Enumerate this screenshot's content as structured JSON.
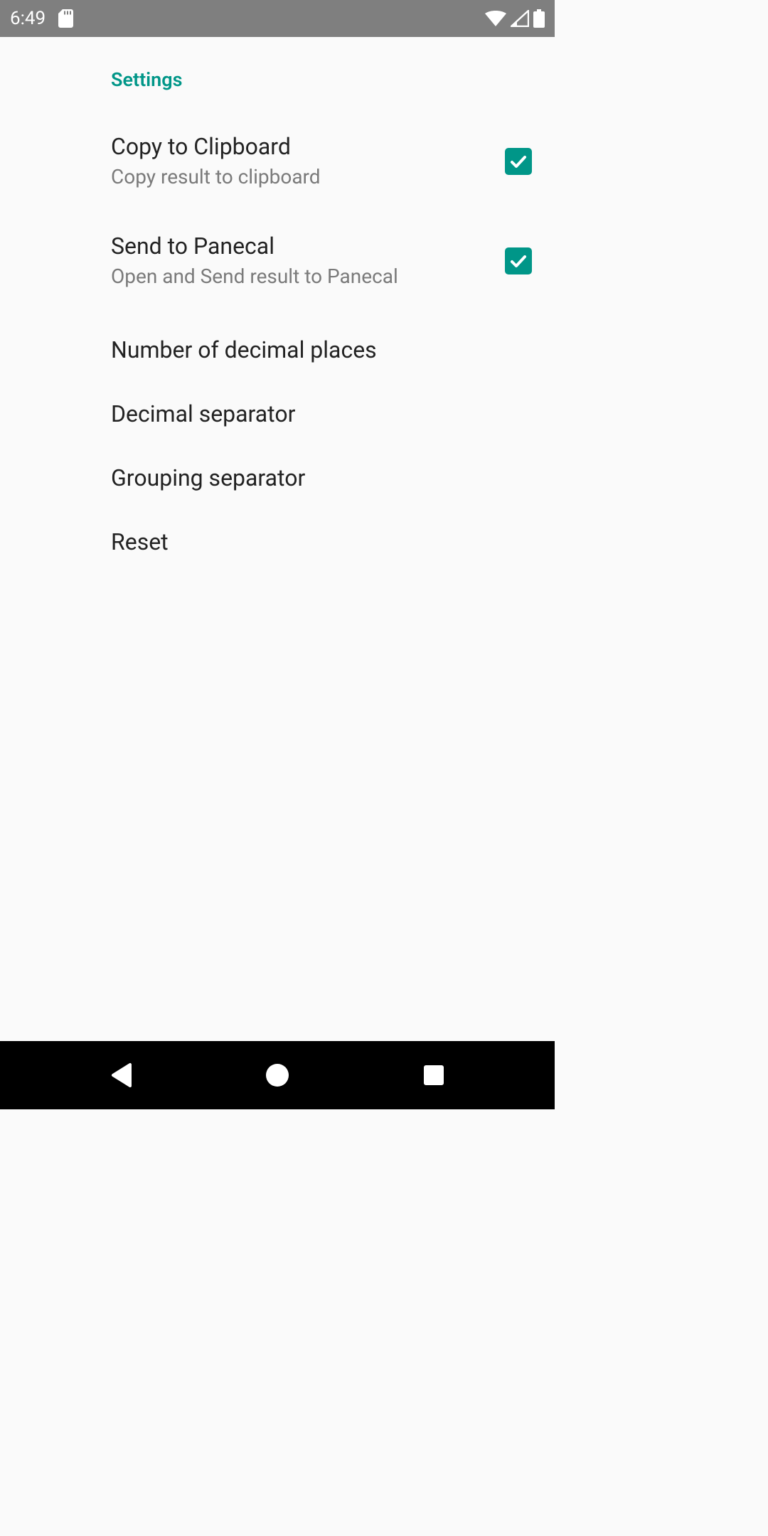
{
  "statusbar": {
    "time": "6:49"
  },
  "page": {
    "section_title": "Settings"
  },
  "settings": {
    "copy_clipboard": {
      "title": "Copy to Clipboard",
      "subtitle": "Copy result to clipboard",
      "checked": true
    },
    "send_panecal": {
      "title": "Send to Panecal",
      "subtitle": "Open and Send result to Panecal",
      "checked": true
    },
    "decimal_places": {
      "title": "Number of decimal places"
    },
    "decimal_separator": {
      "title": "Decimal separator"
    },
    "grouping_separator": {
      "title": "Grouping separator"
    },
    "reset": {
      "title": "Reset"
    }
  },
  "colors": {
    "accent": "#009688",
    "statusbar_bg": "#7f7f7f",
    "navbar_bg": "#000000",
    "page_bg": "#fafafa",
    "text_primary": "#222222",
    "text_secondary": "#7a7a7a"
  }
}
